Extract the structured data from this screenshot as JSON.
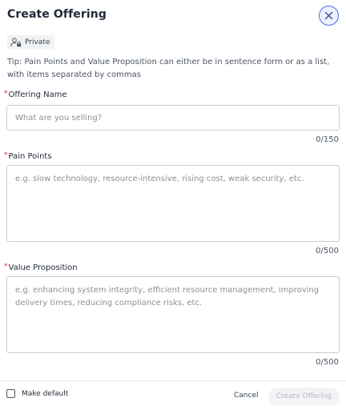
{
  "modal": {
    "title": "Create Offering",
    "visibility_badge": "Private",
    "tip": "Tip: Pain Points and Value Proposition can either be in sentence form or as a list, with items separated by commas"
  },
  "fields": {
    "offering_name": {
      "required_marker": "*",
      "label": "Offering Name",
      "placeholder": "What are you selling?",
      "value": "",
      "counter": "0/150"
    },
    "pain_points": {
      "required_marker": "*",
      "label": "Pain Points",
      "placeholder": "e.g. slow technology, resource-intensive, rising cost, weak security, etc.",
      "value": "",
      "counter": "0/500"
    },
    "value_proposition": {
      "required_marker": "*",
      "label": "Value Proposition",
      "placeholder": "e.g. enhancing system integrity, efficient resource management, improving delivery times, reducing compliance risks, etc.",
      "value": "",
      "counter": "0/500"
    }
  },
  "footer": {
    "make_default_label": "Make default",
    "make_default_checked": false,
    "cancel_label": "Cancel",
    "submit_label": "Create Offering"
  },
  "colors": {
    "accent": "#4f6bed",
    "required": "#dc2626",
    "disabled_text": "#b4b8c0"
  },
  "icons": {
    "close": "close-icon",
    "private": "user-lock-icon"
  }
}
